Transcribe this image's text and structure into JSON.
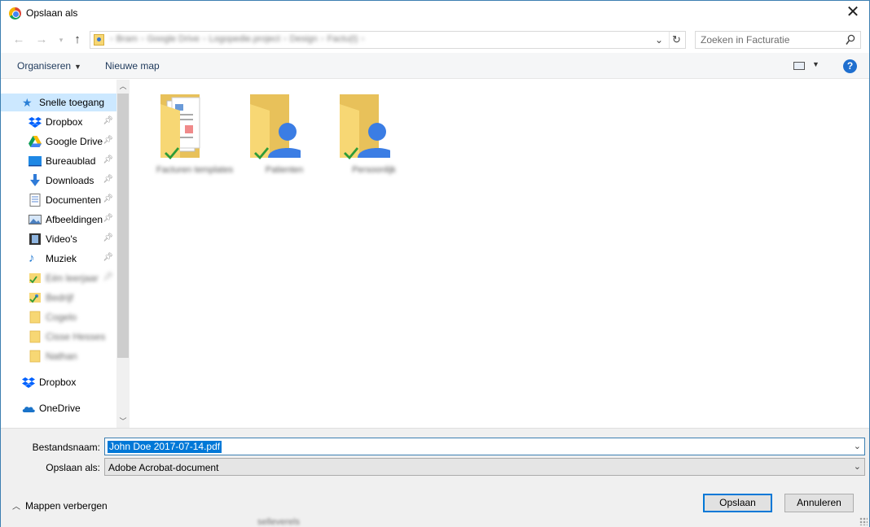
{
  "window": {
    "title": "Opslaan als"
  },
  "nav": {
    "breadcrumbs": [
      "Bram",
      "Google Drive",
      "Logopedie.project",
      "Design",
      "Factu(t)"
    ],
    "search_placeholder": "Zoeken in Facturatie"
  },
  "toolbar": {
    "organize_label": "Organiseren",
    "new_folder_label": "Nieuwe map"
  },
  "sidebar": {
    "quick_access": "Snelle toegang",
    "items": [
      {
        "label": "Dropbox",
        "icon": "dropbox-icon",
        "pinned": true
      },
      {
        "label": "Google Drive",
        "icon": "google-drive-icon",
        "pinned": true
      },
      {
        "label": "Bureaublad",
        "icon": "desktop-icon",
        "pinned": true
      },
      {
        "label": "Downloads",
        "icon": "download-icon",
        "pinned": true
      },
      {
        "label": "Documenten",
        "icon": "documents-icon",
        "pinned": true
      },
      {
        "label": "Afbeeldingen",
        "icon": "pictures-icon",
        "pinned": true
      },
      {
        "label": "Video's",
        "icon": "video-icon",
        "pinned": true
      },
      {
        "label": "Muziek",
        "icon": "music-icon",
        "pinned": true
      },
      {
        "label": "Eén leerjaar",
        "icon": "folder-sync-icon",
        "pinned": true,
        "blurred": true
      },
      {
        "label": "Bedrijf",
        "icon": "folder-sync-icon",
        "pinned": false,
        "blurred": true
      },
      {
        "label": "Cogelo",
        "icon": "folder-icon",
        "pinned": false,
        "blurred": true
      },
      {
        "label": "Cisse Hesses",
        "icon": "folder-icon",
        "pinned": false,
        "blurred": true
      },
      {
        "label": "Nathan",
        "icon": "folder-icon",
        "pinned": false,
        "blurred": true
      }
    ],
    "dropbox": "Dropbox",
    "onedrive": "OneDrive"
  },
  "content": {
    "folders": [
      {
        "label": "Facturen templates",
        "type": "documents"
      },
      {
        "label": "Patienten",
        "type": "shared"
      },
      {
        "label": "Persoonlijk",
        "type": "shared"
      }
    ]
  },
  "bottom": {
    "filename_label": "Bestandsnaam:",
    "filename_value": "John Doe 2017-07-14.pdf",
    "filetype_label": "Opslaan als:",
    "filetype_value": "Adobe Acrobat-document",
    "hide_folders_label": "Mappen verbergen",
    "save_label": "Opslaan",
    "cancel_label": "Annuleren"
  },
  "background_text": "selleverels",
  "colors": {
    "accent": "#0078d7",
    "selection": "#cce8ff",
    "folder": "#f7d774",
    "shared_person": "#3b7de4",
    "sync_check": "#2e9c38",
    "help": "#1f6fcf"
  }
}
